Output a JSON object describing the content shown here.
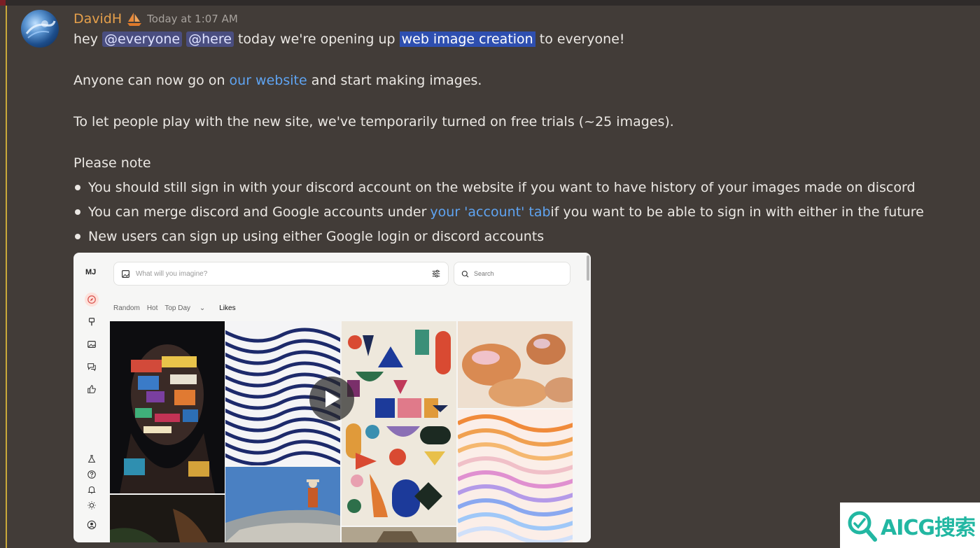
{
  "message": {
    "author": "DavidH",
    "timestamp": "Today at 1:07 AM",
    "line1": {
      "prefix": "hey ",
      "mention_everyone": "@everyone",
      "mention_here": "@here",
      "middle": " today we're opening up ",
      "highlight": "web image creation",
      "suffix": " to everyone!"
    },
    "line2": {
      "prefix": "Anyone can now go on ",
      "link": "our website",
      "suffix": " and start making images."
    },
    "line3": "To let people play with the new site, we've temporarily turned on free trials (~25 images).",
    "note_heading": "Please note",
    "bullets": {
      "b1": "You should still sign in with your discord account on the website if you want to have history of your images made on discord",
      "b2_prefix": "You can merge discord and Google accounts under ",
      "b2_link": "your 'account' tab",
      "b2_suffix": " if you want to be able to sign in with either in the future",
      "b3": "New users can sign up using either Google login or discord accounts"
    }
  },
  "embed": {
    "logo": "MJ",
    "imagine_placeholder": "What will you imagine?",
    "search_placeholder": "Search",
    "tabs": [
      "Random",
      "Hot",
      "Top Day",
      "Likes"
    ],
    "active_tab": "Likes"
  },
  "watermark": {
    "text": "AICG搜索"
  },
  "colors": {
    "background": "#423c38",
    "author": "#e6a04b",
    "link": "#5fa4f2",
    "mention_bg": "#4a4e80",
    "highlight_bg": "#2e4fb0",
    "watermark": "#22b7a2"
  }
}
